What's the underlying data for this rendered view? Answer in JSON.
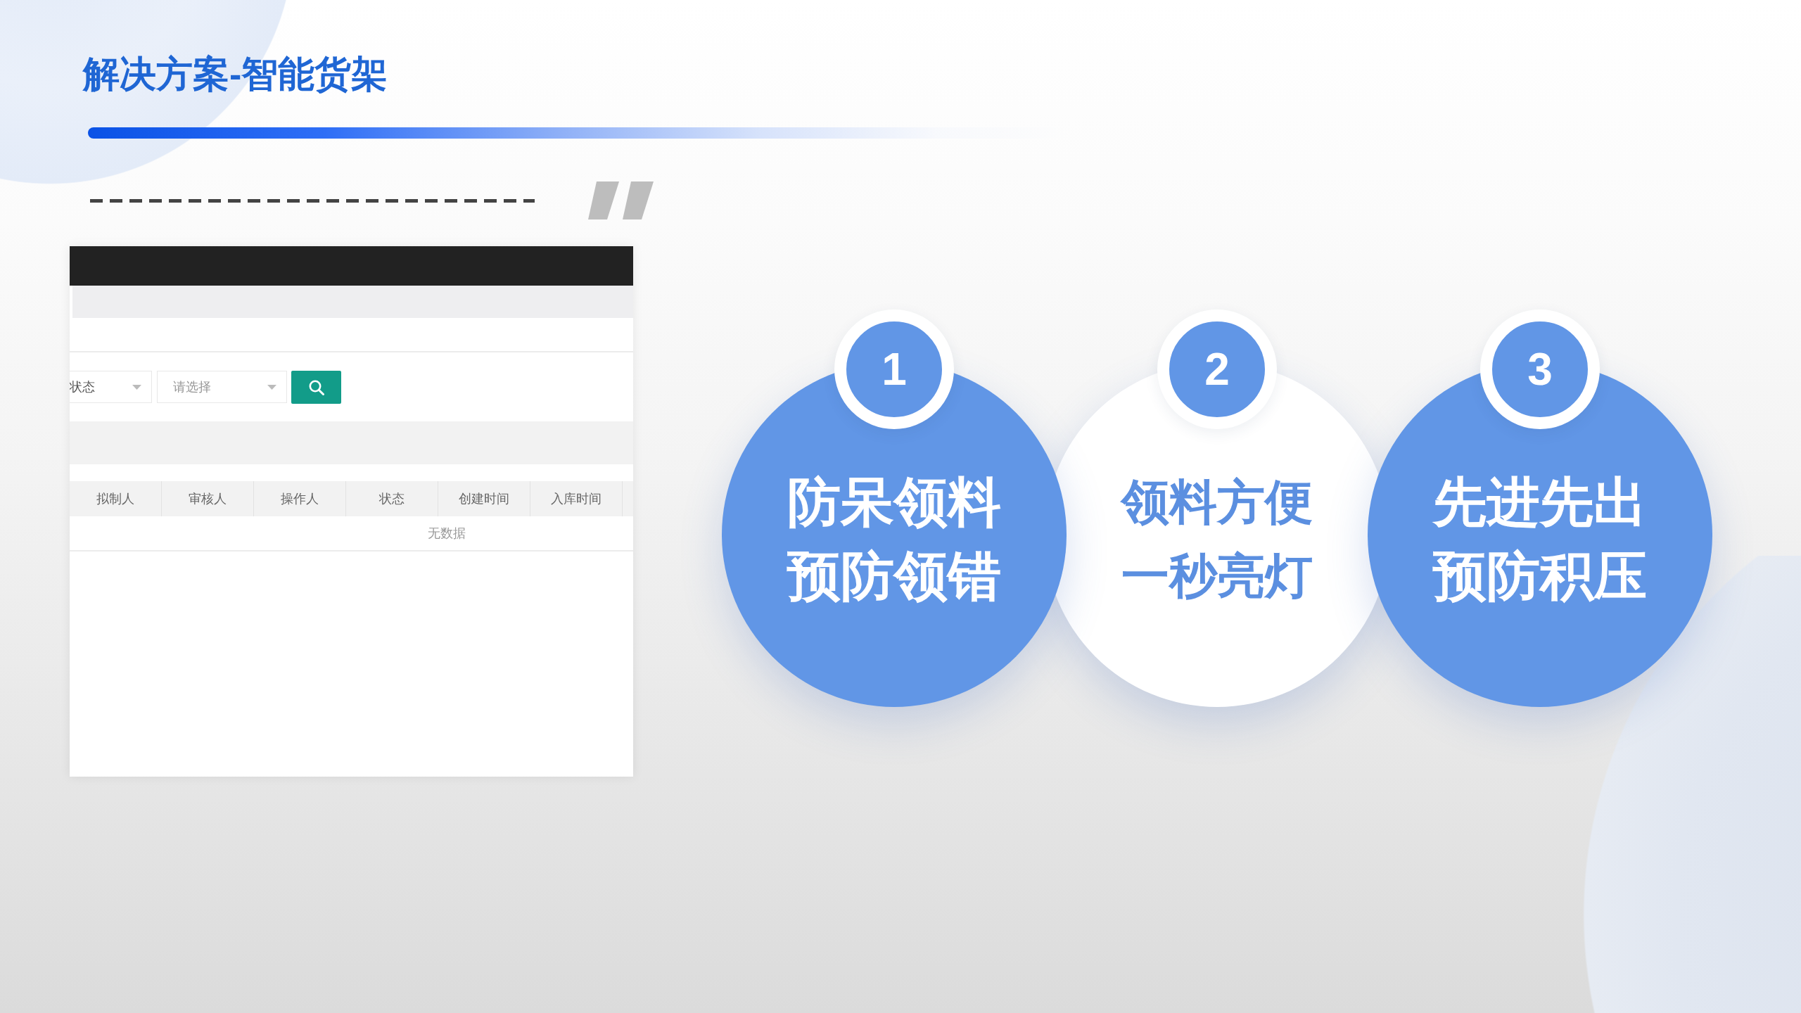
{
  "title": "解决方案-智能货架",
  "screenshot": {
    "filters": [
      {
        "value": "状态"
      },
      {
        "placeholder": "请选择"
      }
    ],
    "table": {
      "columns": [
        "拟制人",
        "审核人",
        "操作人",
        "状态",
        "创建时间",
        "入库时间"
      ],
      "empty_text": "无数据"
    }
  },
  "features": [
    {
      "number": "1",
      "kind": "filled",
      "lines": [
        "防呆领料",
        "预防领错"
      ]
    },
    {
      "number": "2",
      "kind": "plain",
      "lines": [
        "领料方便",
        "一秒亮灯"
      ]
    },
    {
      "number": "3",
      "kind": "filled",
      "lines": [
        "先进先出",
        "预防积压"
      ]
    }
  ]
}
